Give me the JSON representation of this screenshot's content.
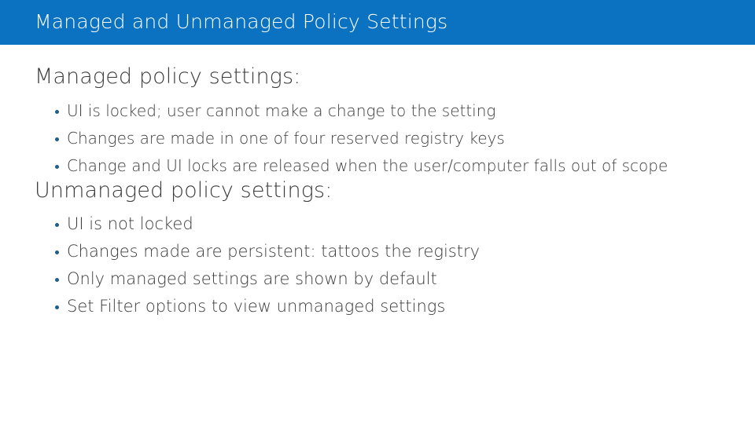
{
  "slide": {
    "title": "Managed and Unmanaged Policy Settings",
    "title_band_color": "#0a72c0",
    "title_text_color": "#ffffff",
    "background_color": "#ffffff",
    "body_text_color": "#3c3c3c",
    "bullet_color": "#1f5e85",
    "bullet_glyph": "bullet-dot"
  },
  "sections": [
    {
      "heading": "Managed policy settings:",
      "bullets": [
        "UI is locked; user cannot make a change to the setting",
        "Changes are made in one of four reserved registry keys",
        "Change and UI locks are released when the user/computer falls out of scope"
      ]
    },
    {
      "heading": "Unmanaged policy settings:",
      "bullets": [
        "UI is not locked",
        "Changes made are persistent: tattoos the registry",
        "Only managed settings are shown by default",
        "Set Filter options to view unmanaged settings"
      ]
    }
  ]
}
